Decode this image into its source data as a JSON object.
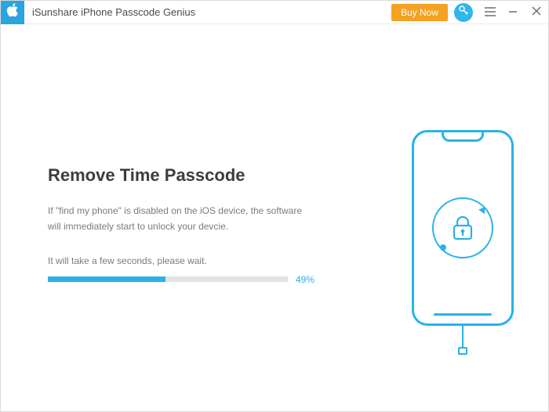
{
  "titlebar": {
    "app_name": "iSunshare iPhone Passcode Genius",
    "buy_now_label": "Buy Now"
  },
  "main": {
    "heading": "Remove Time Passcode",
    "description": "If \"find my phone\" is disabled on the iOS device, the software will immediately start to unlock your devcie.",
    "wait_text": "It will take a few seconds, please wait.",
    "progress_percent": 49,
    "progress_label": "49%"
  },
  "colors": {
    "accent": "#29b2e8",
    "buy_now": "#f5a122"
  }
}
